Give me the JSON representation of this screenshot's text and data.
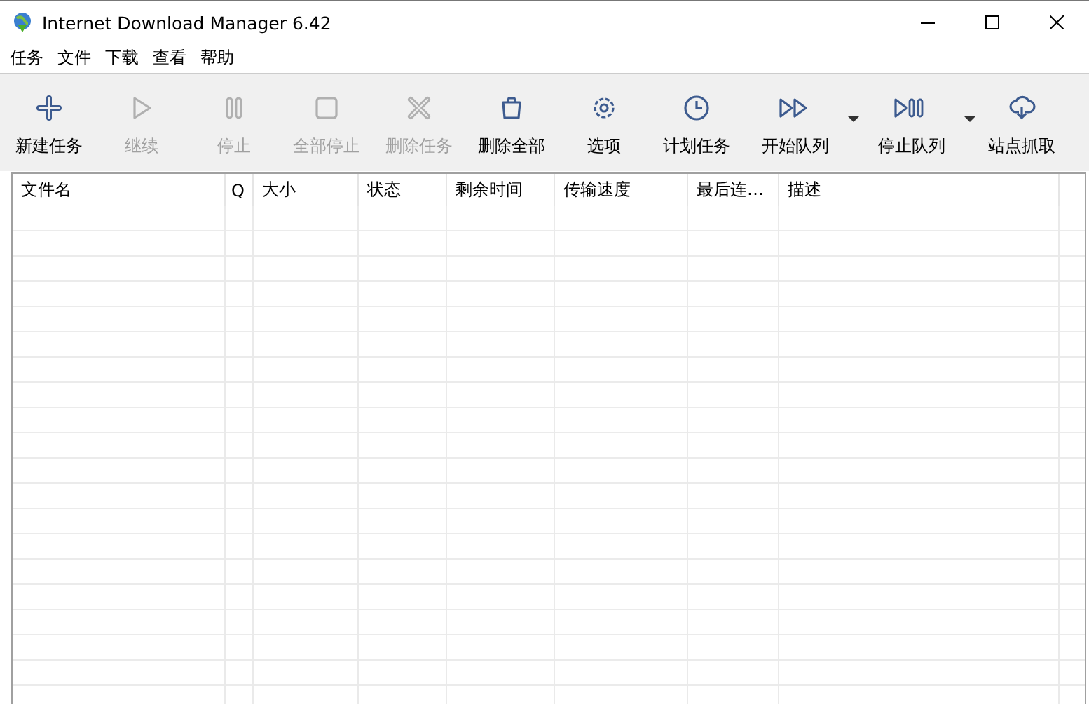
{
  "window": {
    "title": "Internet Download Manager 6.42"
  },
  "menu": [
    "任务",
    "文件",
    "下载",
    "查看",
    "帮助"
  ],
  "toolbar": [
    {
      "label": "新建任务",
      "kind": "add",
      "disabled": false,
      "dropdown": false
    },
    {
      "label": "继续",
      "kind": "resume",
      "disabled": true,
      "dropdown": false
    },
    {
      "label": "停止",
      "kind": "pause",
      "disabled": true,
      "dropdown": false
    },
    {
      "label": "全部停止",
      "kind": "stop",
      "disabled": true,
      "dropdown": false
    },
    {
      "label": "删除任务",
      "kind": "delete",
      "disabled": true,
      "dropdown": false
    },
    {
      "label": "删除全部",
      "kind": "trash",
      "disabled": false,
      "dropdown": false
    },
    {
      "label": "选项",
      "kind": "gear",
      "disabled": false,
      "dropdown": false
    },
    {
      "label": "计划任务",
      "kind": "clock",
      "disabled": false,
      "dropdown": false
    },
    {
      "label": "开始队列",
      "kind": "start-queue",
      "disabled": false,
      "dropdown": true
    },
    {
      "label": "停止队列",
      "kind": "stop-queue",
      "disabled": false,
      "dropdown": true
    },
    {
      "label": "站点抓取",
      "kind": "cloud",
      "disabled": false,
      "dropdown": false
    }
  ],
  "table": {
    "columns": [
      "文件名",
      "Q",
      "大小",
      "状态",
      "剩余时间",
      "传输速度",
      "最后连…",
      "描述"
    ]
  }
}
